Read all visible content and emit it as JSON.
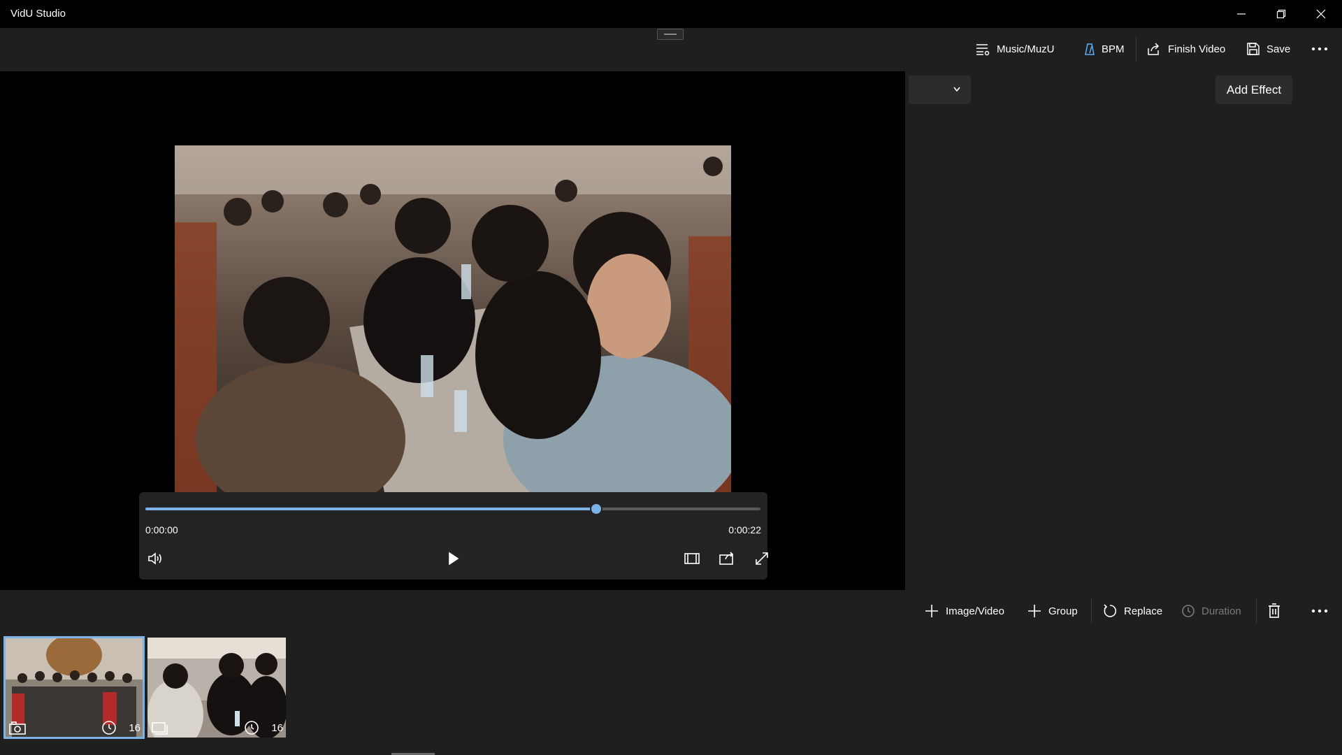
{
  "window": {
    "title": "VidU Studio"
  },
  "toolbar": {
    "music_label": "Music/MuzU",
    "bpm_label": "BPM",
    "finish_label": "Finish Video",
    "save_label": "Save"
  },
  "player": {
    "current_time": "0:00:00",
    "total_time": "0:00:22",
    "progress": 0.733
  },
  "effects": {
    "combo_value": "",
    "add_effect_label": "Add Effect"
  },
  "commands": {
    "image_video_label": "Image/Video",
    "group_label": "Group",
    "replace_label": "Replace",
    "duration_label": "Duration"
  },
  "storyboard": {
    "items": [
      {
        "type": "photo",
        "duration": "16",
        "selected": true
      },
      {
        "type": "video",
        "duration": "16",
        "selected": false
      }
    ]
  },
  "colors": {
    "accent": "#7cb4e8",
    "background": "#1f1f1f",
    "titlebar": "#000000"
  }
}
